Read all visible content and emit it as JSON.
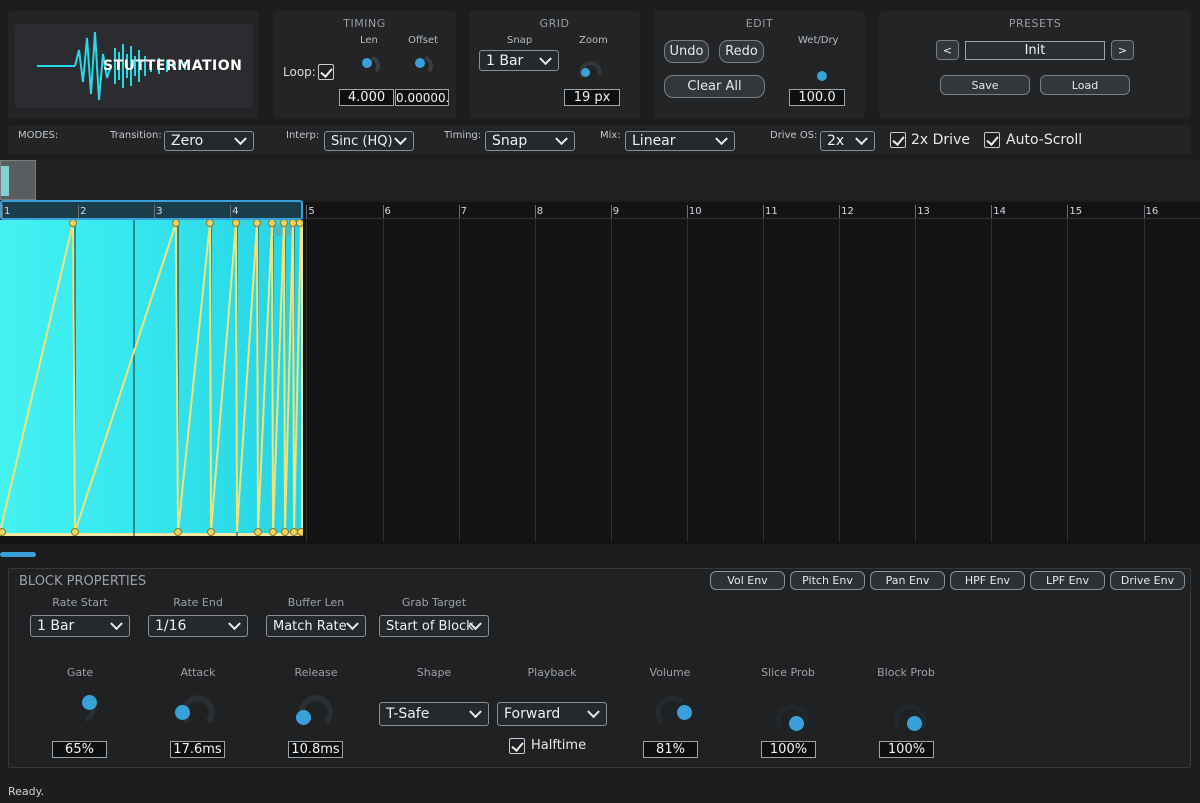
{
  "logo": {
    "text": "STUTTERMATION"
  },
  "timing": {
    "title": "TIMING",
    "len_label": "Len",
    "offset_label": "Offset",
    "loop_label": "Loop:",
    "len_value": "4.000",
    "offset_value": "0.00000..."
  },
  "grid": {
    "title": "GRID",
    "snap_label": "Snap",
    "zoom_label": "Zoom",
    "snap_value": "1 Bar",
    "zoom_value": "19 px"
  },
  "edit": {
    "title": "EDIT",
    "undo": "Undo",
    "redo": "Redo",
    "clear_all": "Clear All",
    "wetdry_label": "Wet/Dry",
    "wetdry_value": "100.0"
  },
  "presets": {
    "title": "PRESETS",
    "prev": "<",
    "next": ">",
    "name": "Init",
    "save": "Save",
    "load": "Load"
  },
  "modes": {
    "label": "MODES:",
    "transition_label": "Transition:",
    "transition_value": "Zero",
    "interp_label": "Interp:",
    "interp_value": "Sinc (HQ)",
    "timing_label": "Timing:",
    "timing_value": "Snap",
    "mix_label": "Mix:",
    "mix_value": "Linear",
    "driveos_label": "Drive OS:",
    "driveos_value": "2x",
    "drive2x_label": "2x Drive",
    "autoscroll_label": "Auto-Scroll"
  },
  "ruler": {
    "bars": [
      "1",
      "2",
      "3",
      "4",
      "5",
      "6",
      "7",
      "8",
      "9",
      "10",
      "11",
      "12",
      "13",
      "14",
      "15",
      "16"
    ]
  },
  "block_properties": {
    "title": "BLOCK PROPERTIES",
    "env_buttons": [
      "Vol Env",
      "Pitch Env",
      "Pan Env",
      "HPF Env",
      "LPF Env",
      "Drive Env"
    ],
    "rate_start_label": "Rate Start",
    "rate_start_value": "1 Bar",
    "rate_end_label": "Rate End",
    "rate_end_value": "1/16",
    "buffer_len_label": "Buffer Len",
    "buffer_len_value": "Match Rate",
    "grab_target_label": "Grab Target",
    "grab_target_value": "Start of Block",
    "gate_label": "Gate",
    "gate_value": "65%",
    "attack_label": "Attack",
    "attack_value": "17.6ms",
    "release_label": "Release",
    "release_value": "10.8ms",
    "shape_label": "Shape",
    "shape_value": "T-Safe",
    "playback_label": "Playback",
    "playback_value": "Forward",
    "halftime_label": "Halftime",
    "volume_label": "Volume",
    "volume_value": "81%",
    "slice_prob_label": "Slice Prob",
    "slice_prob_value": "100%",
    "block_prob_label": "Block Prob",
    "block_prob_value": "100%"
  },
  "status": {
    "text": "Ready."
  },
  "colors": {
    "accent": "#3aa1d8",
    "block_fill": "#3ef0f0",
    "envelope": "#f2e27a",
    "logo": "#2ad7e6"
  }
}
